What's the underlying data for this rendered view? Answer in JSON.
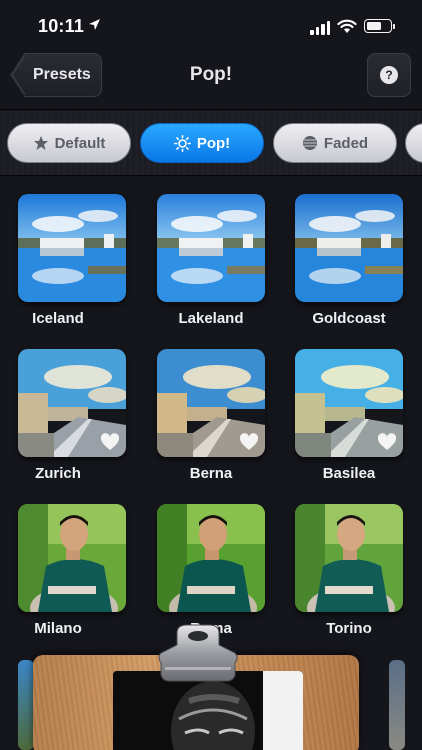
{
  "status_bar": {
    "time": "10:11"
  },
  "nav": {
    "back_label": "Presets",
    "title": "Pop!",
    "help_label": "?"
  },
  "filters": [
    {
      "label": "Default",
      "icon": "star-icon",
      "state": "inactive"
    },
    {
      "label": "Pop!",
      "icon": "sun-icon",
      "state": "active"
    },
    {
      "label": "Faded",
      "icon": "faded-circle-icon",
      "state": "inactive"
    }
  ],
  "presets": [
    {
      "label": "Iceland",
      "image": "lake-landscape",
      "favorite": false
    },
    {
      "label": "Lakeland",
      "image": "lake-landscape",
      "favorite": false
    },
    {
      "label": "Goldcoast",
      "image": "lake-landscape",
      "favorite": false
    },
    {
      "label": "Zurich",
      "image": "walkway-landscape",
      "favorite": true
    },
    {
      "label": "Berna",
      "image": "walkway-landscape",
      "favorite": true
    },
    {
      "label": "Basilea",
      "image": "walkway-landscape",
      "favorite": true
    },
    {
      "label": "Milano",
      "image": "man-portrait",
      "favorite": false
    },
    {
      "label": "Roma",
      "image": "man-portrait",
      "favorite": false
    },
    {
      "label": "Torino",
      "image": "man-portrait",
      "favorite": false
    }
  ],
  "colors": {
    "accent": "#0a84ff",
    "background": "#15161c"
  }
}
